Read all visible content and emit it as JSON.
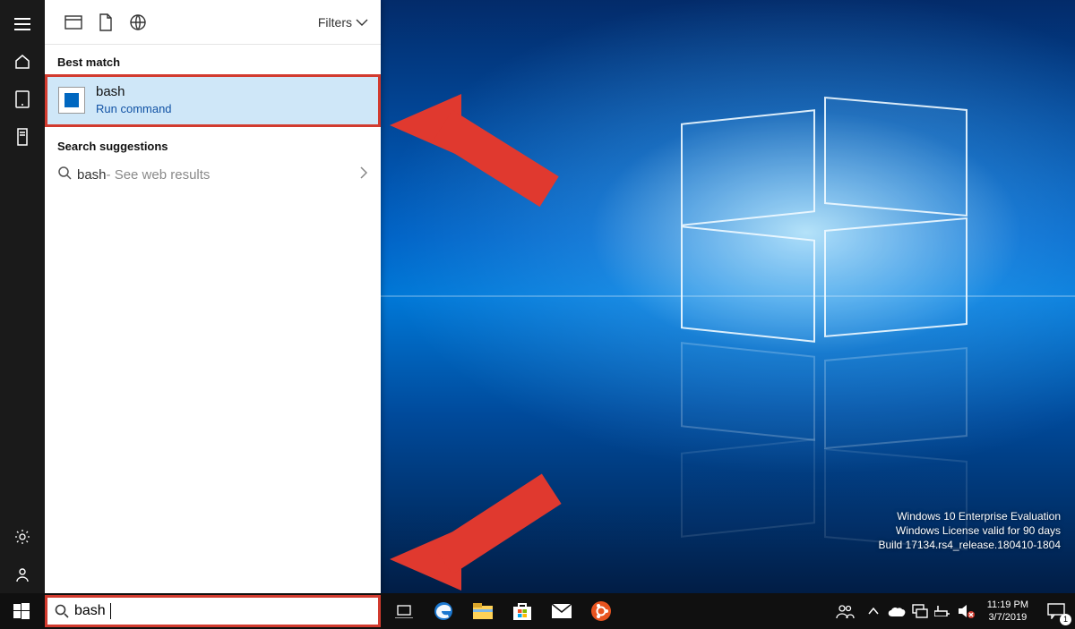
{
  "sidebar": {
    "items": [
      "menu",
      "home",
      "tablet",
      "tower"
    ],
    "bottom": [
      "settings",
      "account"
    ]
  },
  "search_panel": {
    "filters_label": "Filters",
    "best_match_label": "Best match",
    "result": {
      "title": "bash",
      "subtitle": "Run command"
    },
    "suggestions_label": "Search suggestions",
    "suggestion": {
      "query": "bash",
      "hint": " - See web results"
    }
  },
  "search_box": {
    "value": "bash"
  },
  "watermark": {
    "line1": "Windows 10 Enterprise Evaluation",
    "line2": "Windows License valid for 90 days",
    "line3": "Build 17134.rs4_release.180410-1804"
  },
  "clock": {
    "time": "11:19 PM",
    "date": "3/7/2019"
  },
  "notifications": {
    "count": "1"
  },
  "taskbar_apps": [
    "task-view",
    "edge",
    "file-explorer",
    "store",
    "mail",
    "ubuntu"
  ],
  "systray": [
    "people",
    "up",
    "onedrive",
    "network",
    "power",
    "volume-muted"
  ],
  "annotations": [
    "arrow-to-result",
    "arrow-to-searchbox"
  ]
}
